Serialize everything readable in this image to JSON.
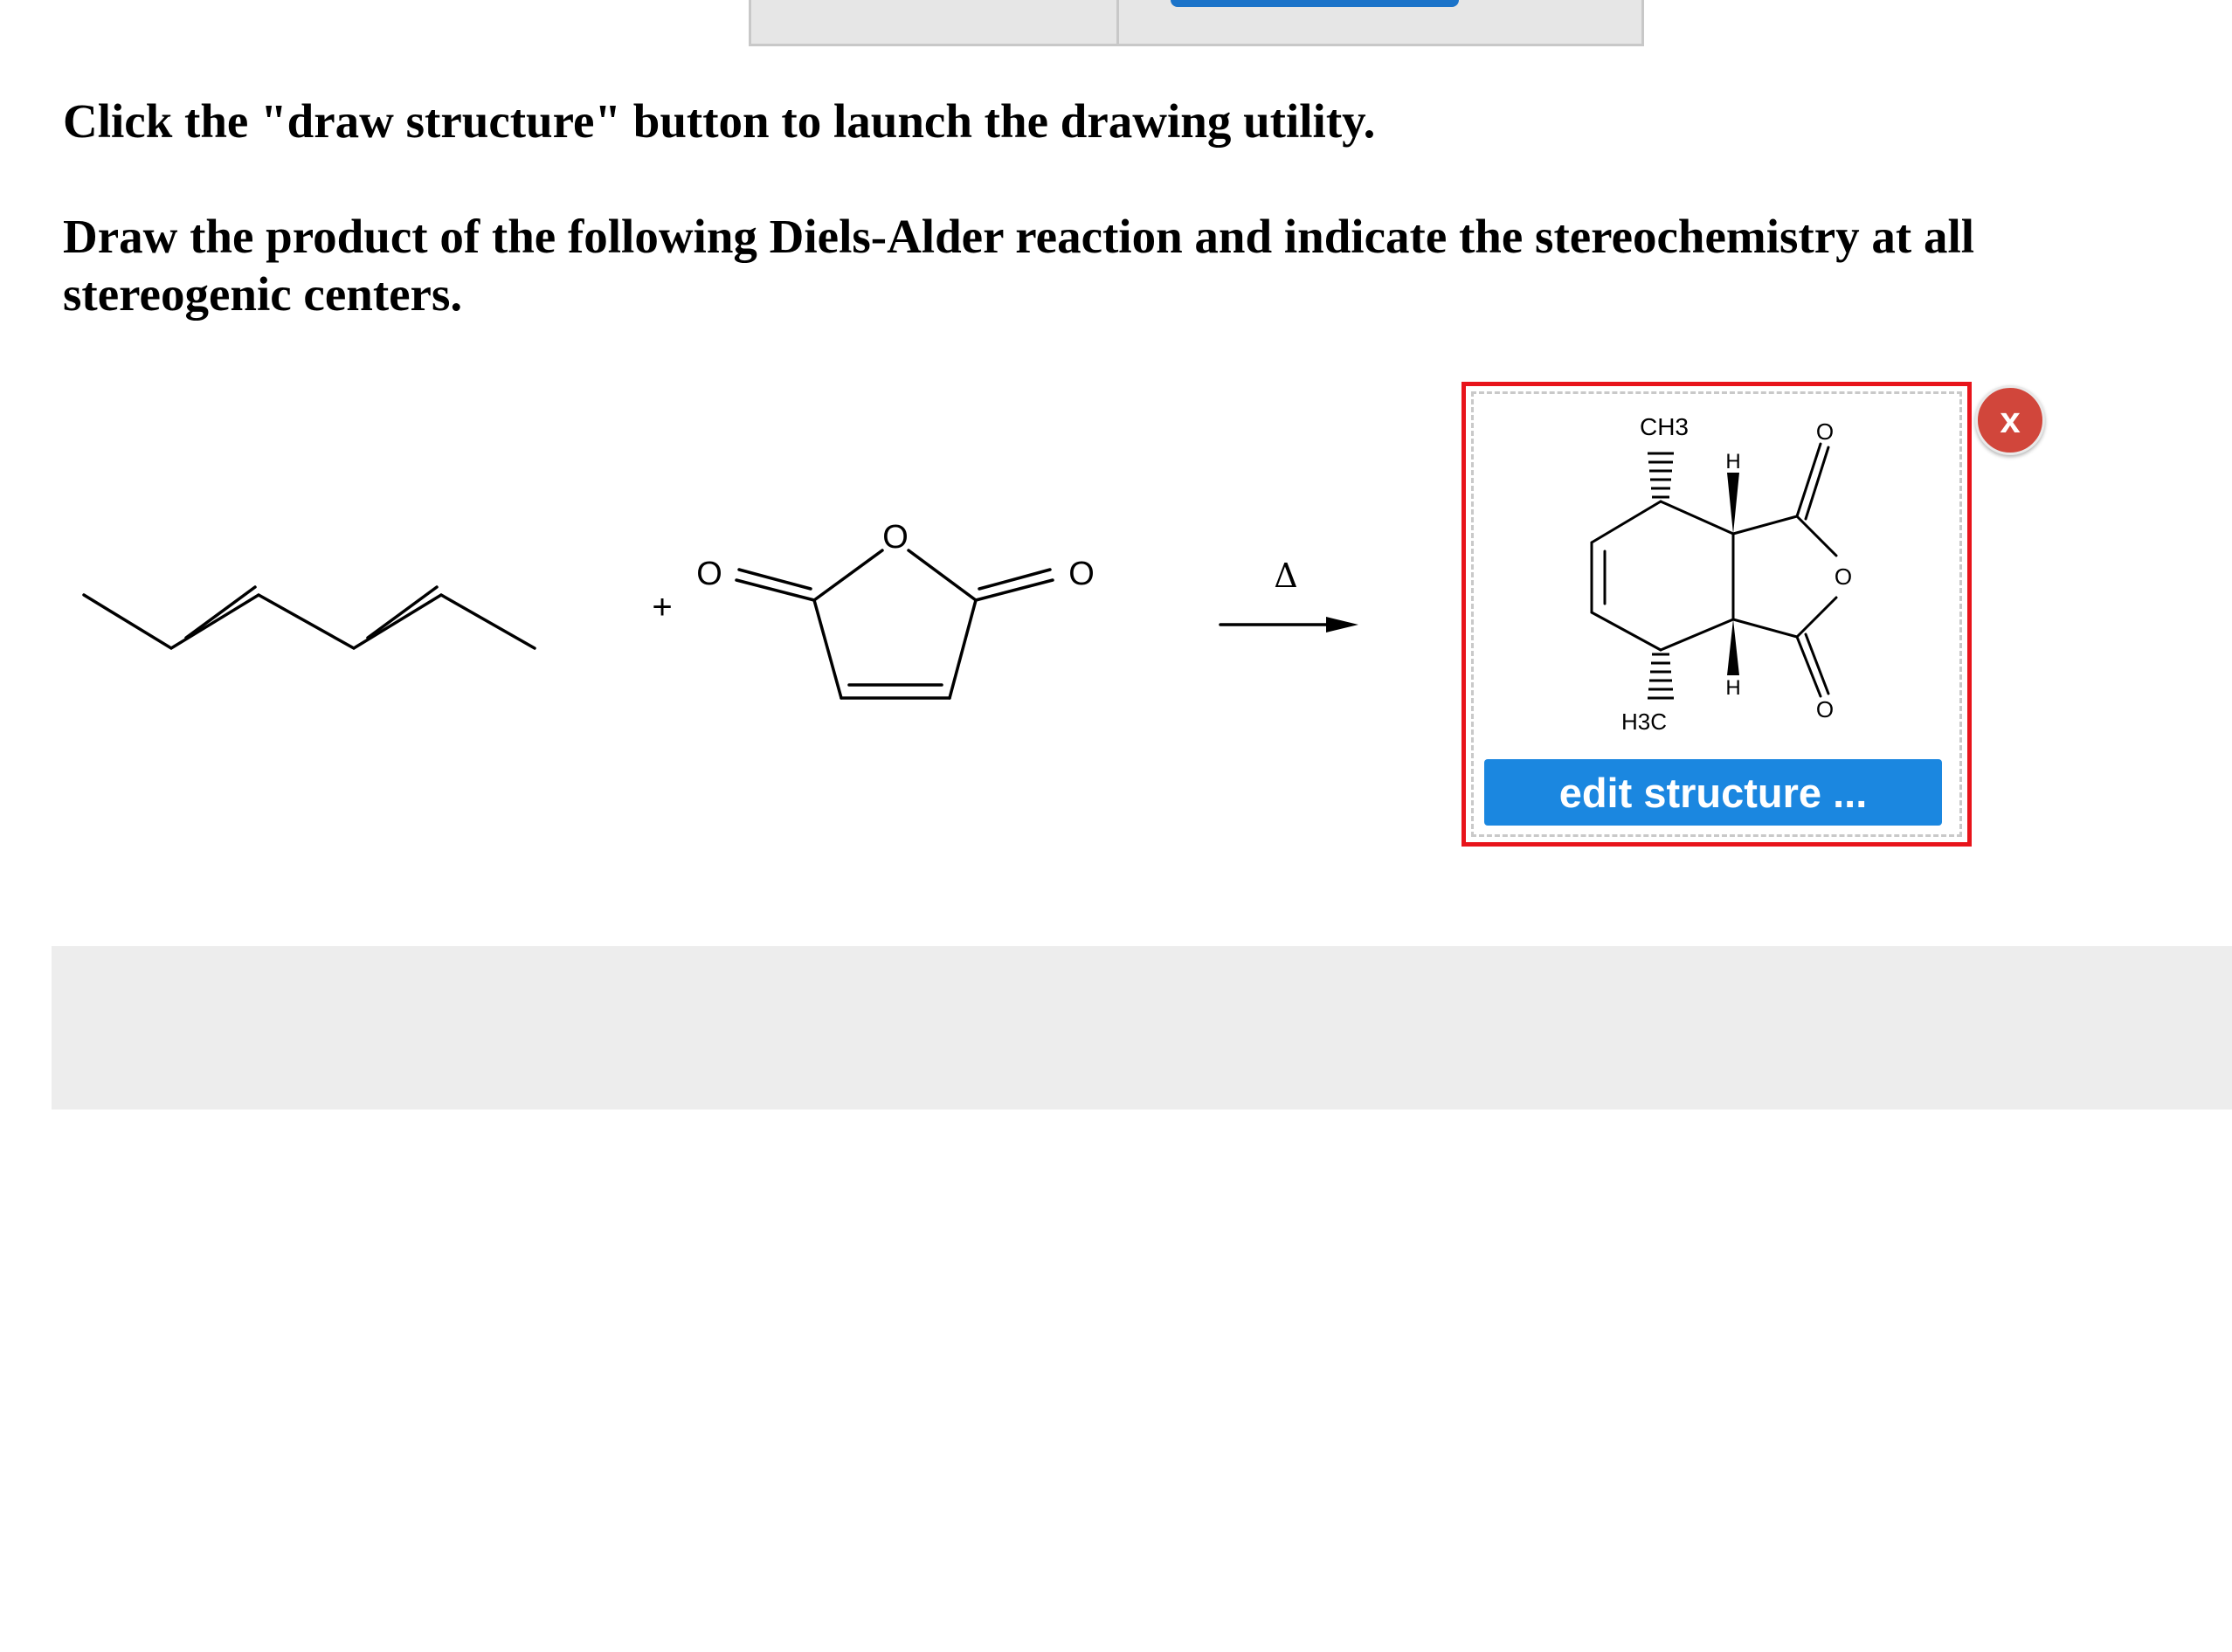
{
  "instructions": {
    "line1": "Click the \"draw structure\" button to launch the drawing utility.",
    "line2": "Draw the product of the following Diels-Alder reaction and indicate the stereochemistry at all stereogenic centers."
  },
  "reaction": {
    "plus": "+",
    "condition": "Δ",
    "anhydride_atoms": {
      "ring_o": "O",
      "left_o": "O",
      "right_o": "O"
    }
  },
  "answer": {
    "labels": {
      "ch3_top": "CH3",
      "h3c_bottom": "H3C",
      "h_top": "H",
      "h_bottom": "H",
      "o_top": "O",
      "o_ring": "O",
      "o_bottom": "O"
    },
    "edit_button": "edit structure ...",
    "close_button": "x"
  },
  "colors": {
    "highlight_border": "#e8141b",
    "button_blue": "#1b87e0",
    "close_red": "#d1463b"
  }
}
